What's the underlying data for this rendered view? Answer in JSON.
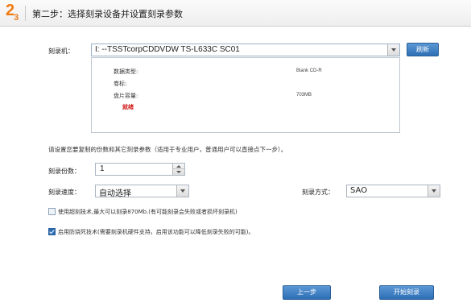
{
  "header": {
    "step_number": "2",
    "step_total": "3",
    "title": "第二步：选择刻录设备并设置刻录参数"
  },
  "burner": {
    "label": "刻录机：",
    "selected": "I:  --TSSTcorpCDDVDW TS-L633C  SC01",
    "refresh_label": "刷新"
  },
  "disc_info": {
    "type_label": "数据类型:",
    "type_value": "Blank CD-R",
    "volume_label": "卷标:",
    "capacity_label": "盘片容量:",
    "capacity_value": "703MB",
    "status": "就绪"
  },
  "hint": "请设置您要复制的份数和其它刻录参数（适用于专业用户，普通用户可以直接点下一步）。",
  "copies": {
    "label": "刻录份数：",
    "value": "1"
  },
  "speed": {
    "label": "刻录速度：",
    "value": "自动选择"
  },
  "mode": {
    "label": "刻录方式：",
    "value": "SAO"
  },
  "options": [
    {
      "label": "使用超刻技术,最大可以刻录870Mb.(有可能刻录会失败或者损坏刻录机)",
      "checked": false
    },
    {
      "label": "启用防烧死技术(需要刻录机硬件支持，启用该功能可以降低刻录失败的可能)。",
      "checked": true
    }
  ],
  "footer": {
    "back_label": "上一步",
    "start_label": "开始刻录"
  },
  "colors": {
    "accent": "#f07a12",
    "button": "#2d6fb6",
    "status": "#d31b1b"
  }
}
